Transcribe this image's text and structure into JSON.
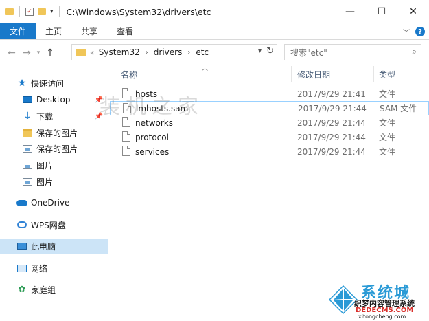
{
  "window": {
    "title": "C:\\Windows\\System32\\drivers\\etc",
    "controls": {
      "minimize": "—",
      "maximize": "☐",
      "close": "✕"
    }
  },
  "ribbon": {
    "tabs": [
      "文件",
      "主页",
      "共享",
      "查看"
    ],
    "help": "?"
  },
  "address": {
    "breadcrumb": [
      "System32",
      "drivers",
      "etc"
    ],
    "overflow": "«"
  },
  "search": {
    "placeholder": "搜索\"etc\""
  },
  "sidebar": {
    "items": [
      {
        "label": "快速访问",
        "icon": "star-icon"
      },
      {
        "label": "Desktop",
        "icon": "desktop-icon",
        "pinned": true
      },
      {
        "label": "下载",
        "icon": "download-icon",
        "pinned": true
      },
      {
        "label": "保存的图片",
        "icon": "folder-icon"
      },
      {
        "label": "保存的图片",
        "icon": "picture-icon"
      },
      {
        "label": "图片",
        "icon": "picture-icon"
      },
      {
        "label": "图片",
        "icon": "picture-icon"
      },
      {
        "label": "OneDrive",
        "icon": "cloud-icon"
      },
      {
        "label": "WPS网盘",
        "icon": "wps-cloud-icon"
      },
      {
        "label": "此电脑",
        "icon": "computer-icon",
        "selected": true
      },
      {
        "label": "网络",
        "icon": "network-icon"
      },
      {
        "label": "家庭组",
        "icon": "homegroup-icon"
      }
    ]
  },
  "columns": {
    "name": "名称",
    "modified": "修改日期",
    "type": "类型"
  },
  "files": [
    {
      "name": "hosts",
      "modified": "2017/9/29 21:41",
      "type": "文件"
    },
    {
      "name": "lmhosts.sam",
      "modified": "2017/9/29 21:44",
      "type": "SAM 文件",
      "selected": true
    },
    {
      "name": "networks",
      "modified": "2017/9/29 21:44",
      "type": "文件"
    },
    {
      "name": "protocol",
      "modified": "2017/9/29 21:44",
      "type": "文件"
    },
    {
      "name": "services",
      "modified": "2017/9/29 21:44",
      "type": "文件"
    }
  ],
  "watermark": {
    "center_text": "装机之家",
    "brand": "系统城",
    "sub": "织梦内容管理系统",
    "url1": "DEDECMS.COM",
    "url2": "xitongcheng.com"
  },
  "colors": {
    "accent": "#1979ca",
    "selection": "#cce4f7",
    "folder": "#f0c659"
  }
}
